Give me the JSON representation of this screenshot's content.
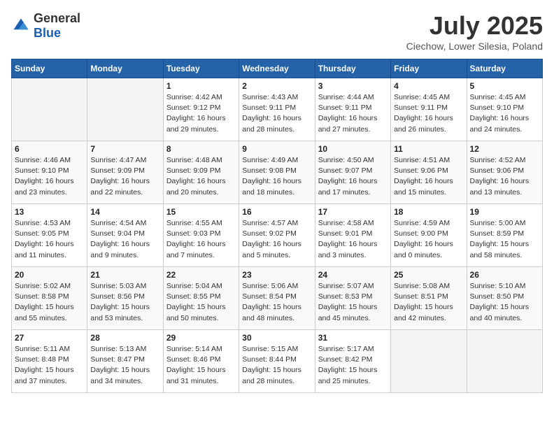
{
  "header": {
    "logo_general": "General",
    "logo_blue": "Blue",
    "month": "July 2025",
    "location": "Ciechow, Lower Silesia, Poland"
  },
  "days_of_week": [
    "Sunday",
    "Monday",
    "Tuesday",
    "Wednesday",
    "Thursday",
    "Friday",
    "Saturday"
  ],
  "weeks": [
    [
      null,
      null,
      {
        "day": "1",
        "sunrise": "Sunrise: 4:42 AM",
        "sunset": "Sunset: 9:12 PM",
        "daylight": "Daylight: 16 hours and 29 minutes."
      },
      {
        "day": "2",
        "sunrise": "Sunrise: 4:43 AM",
        "sunset": "Sunset: 9:11 PM",
        "daylight": "Daylight: 16 hours and 28 minutes."
      },
      {
        "day": "3",
        "sunrise": "Sunrise: 4:44 AM",
        "sunset": "Sunset: 9:11 PM",
        "daylight": "Daylight: 16 hours and 27 minutes."
      },
      {
        "day": "4",
        "sunrise": "Sunrise: 4:45 AM",
        "sunset": "Sunset: 9:11 PM",
        "daylight": "Daylight: 16 hours and 26 minutes."
      },
      {
        "day": "5",
        "sunrise": "Sunrise: 4:45 AM",
        "sunset": "Sunset: 9:10 PM",
        "daylight": "Daylight: 16 hours and 24 minutes."
      }
    ],
    [
      {
        "day": "6",
        "sunrise": "Sunrise: 4:46 AM",
        "sunset": "Sunset: 9:10 PM",
        "daylight": "Daylight: 16 hours and 23 minutes."
      },
      {
        "day": "7",
        "sunrise": "Sunrise: 4:47 AM",
        "sunset": "Sunset: 9:09 PM",
        "daylight": "Daylight: 16 hours and 22 minutes."
      },
      {
        "day": "8",
        "sunrise": "Sunrise: 4:48 AM",
        "sunset": "Sunset: 9:09 PM",
        "daylight": "Daylight: 16 hours and 20 minutes."
      },
      {
        "day": "9",
        "sunrise": "Sunrise: 4:49 AM",
        "sunset": "Sunset: 9:08 PM",
        "daylight": "Daylight: 16 hours and 18 minutes."
      },
      {
        "day": "10",
        "sunrise": "Sunrise: 4:50 AM",
        "sunset": "Sunset: 9:07 PM",
        "daylight": "Daylight: 16 hours and 17 minutes."
      },
      {
        "day": "11",
        "sunrise": "Sunrise: 4:51 AM",
        "sunset": "Sunset: 9:06 PM",
        "daylight": "Daylight: 16 hours and 15 minutes."
      },
      {
        "day": "12",
        "sunrise": "Sunrise: 4:52 AM",
        "sunset": "Sunset: 9:06 PM",
        "daylight": "Daylight: 16 hours and 13 minutes."
      }
    ],
    [
      {
        "day": "13",
        "sunrise": "Sunrise: 4:53 AM",
        "sunset": "Sunset: 9:05 PM",
        "daylight": "Daylight: 16 hours and 11 minutes."
      },
      {
        "day": "14",
        "sunrise": "Sunrise: 4:54 AM",
        "sunset": "Sunset: 9:04 PM",
        "daylight": "Daylight: 16 hours and 9 minutes."
      },
      {
        "day": "15",
        "sunrise": "Sunrise: 4:55 AM",
        "sunset": "Sunset: 9:03 PM",
        "daylight": "Daylight: 16 hours and 7 minutes."
      },
      {
        "day": "16",
        "sunrise": "Sunrise: 4:57 AM",
        "sunset": "Sunset: 9:02 PM",
        "daylight": "Daylight: 16 hours and 5 minutes."
      },
      {
        "day": "17",
        "sunrise": "Sunrise: 4:58 AM",
        "sunset": "Sunset: 9:01 PM",
        "daylight": "Daylight: 16 hours and 3 minutes."
      },
      {
        "day": "18",
        "sunrise": "Sunrise: 4:59 AM",
        "sunset": "Sunset: 9:00 PM",
        "daylight": "Daylight: 16 hours and 0 minutes."
      },
      {
        "day": "19",
        "sunrise": "Sunrise: 5:00 AM",
        "sunset": "Sunset: 8:59 PM",
        "daylight": "Daylight: 15 hours and 58 minutes."
      }
    ],
    [
      {
        "day": "20",
        "sunrise": "Sunrise: 5:02 AM",
        "sunset": "Sunset: 8:58 PM",
        "daylight": "Daylight: 15 hours and 55 minutes."
      },
      {
        "day": "21",
        "sunrise": "Sunrise: 5:03 AM",
        "sunset": "Sunset: 8:56 PM",
        "daylight": "Daylight: 15 hours and 53 minutes."
      },
      {
        "day": "22",
        "sunrise": "Sunrise: 5:04 AM",
        "sunset": "Sunset: 8:55 PM",
        "daylight": "Daylight: 15 hours and 50 minutes."
      },
      {
        "day": "23",
        "sunrise": "Sunrise: 5:06 AM",
        "sunset": "Sunset: 8:54 PM",
        "daylight": "Daylight: 15 hours and 48 minutes."
      },
      {
        "day": "24",
        "sunrise": "Sunrise: 5:07 AM",
        "sunset": "Sunset: 8:53 PM",
        "daylight": "Daylight: 15 hours and 45 minutes."
      },
      {
        "day": "25",
        "sunrise": "Sunrise: 5:08 AM",
        "sunset": "Sunset: 8:51 PM",
        "daylight": "Daylight: 15 hours and 42 minutes."
      },
      {
        "day": "26",
        "sunrise": "Sunrise: 5:10 AM",
        "sunset": "Sunset: 8:50 PM",
        "daylight": "Daylight: 15 hours and 40 minutes."
      }
    ],
    [
      {
        "day": "27",
        "sunrise": "Sunrise: 5:11 AM",
        "sunset": "Sunset: 8:48 PM",
        "daylight": "Daylight: 15 hours and 37 minutes."
      },
      {
        "day": "28",
        "sunrise": "Sunrise: 5:13 AM",
        "sunset": "Sunset: 8:47 PM",
        "daylight": "Daylight: 15 hours and 34 minutes."
      },
      {
        "day": "29",
        "sunrise": "Sunrise: 5:14 AM",
        "sunset": "Sunset: 8:46 PM",
        "daylight": "Daylight: 15 hours and 31 minutes."
      },
      {
        "day": "30",
        "sunrise": "Sunrise: 5:15 AM",
        "sunset": "Sunset: 8:44 PM",
        "daylight": "Daylight: 15 hours and 28 minutes."
      },
      {
        "day": "31",
        "sunrise": "Sunrise: 5:17 AM",
        "sunset": "Sunset: 8:42 PM",
        "daylight": "Daylight: 15 hours and 25 minutes."
      },
      null,
      null
    ]
  ]
}
